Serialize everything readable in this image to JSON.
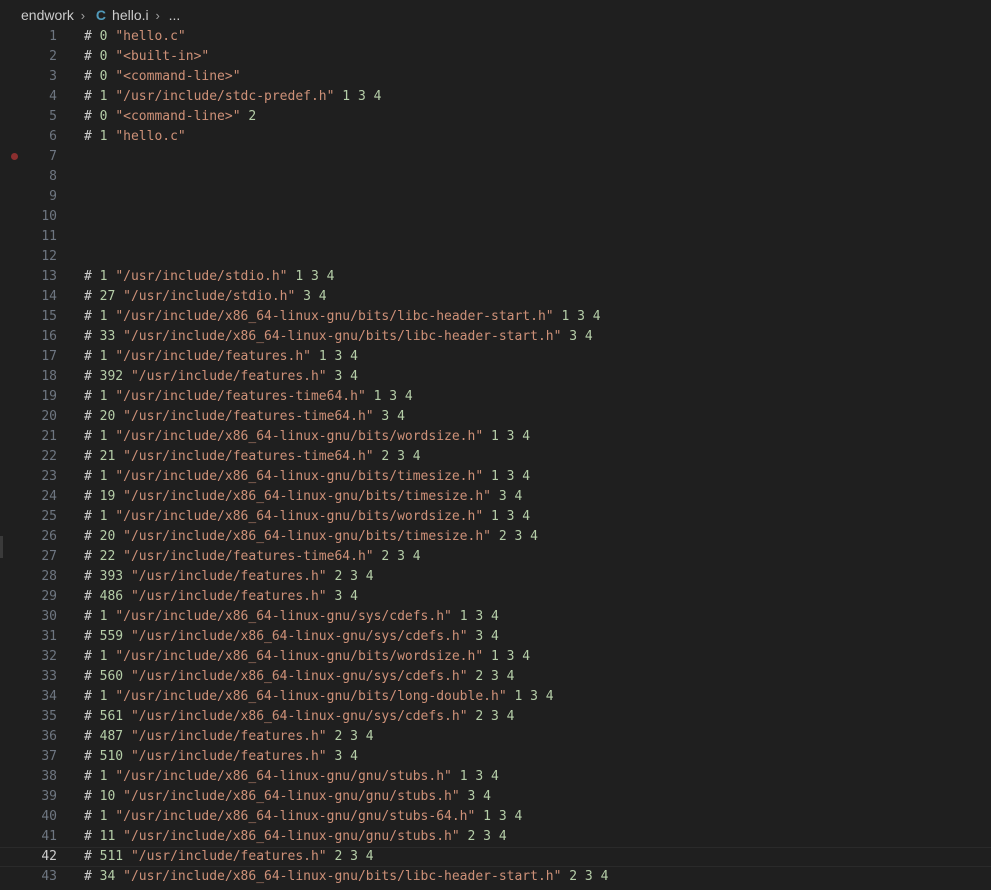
{
  "breadcrumb": {
    "folder": "endwork",
    "file_icon": "C",
    "file": "hello.i",
    "more": "..."
  },
  "colors": {
    "background": "#1f1f1f",
    "line_number": "#6e7681",
    "active_line_number": "#cccccc",
    "string": "#ce9178",
    "number": "#b5cea8",
    "c_icon": "#519aba",
    "breakpoint": "#8c2f2f"
  },
  "editor": {
    "active_line": 42,
    "breakpoint_line": 7,
    "lines": [
      {
        "n": "1",
        "hash": "#",
        "num": "0",
        "str": "\"hello.c\"",
        "flags": ""
      },
      {
        "n": "2",
        "hash": "#",
        "num": "0",
        "str": "\"<built-in>\"",
        "flags": ""
      },
      {
        "n": "3",
        "hash": "#",
        "num": "0",
        "str": "\"<command-line>\"",
        "flags": ""
      },
      {
        "n": "4",
        "hash": "#",
        "num": "1",
        "str": "\"/usr/include/stdc-predef.h\"",
        "flags": "1 3 4"
      },
      {
        "n": "5",
        "hash": "#",
        "num": "0",
        "str": "\"<command-line>\"",
        "flags": "2"
      },
      {
        "n": "6",
        "hash": "#",
        "num": "1",
        "str": "\"hello.c\"",
        "flags": ""
      },
      {
        "n": "7",
        "hash": "",
        "num": "",
        "str": "",
        "flags": ""
      },
      {
        "n": "8",
        "hash": "",
        "num": "",
        "str": "",
        "flags": ""
      },
      {
        "n": "9",
        "hash": "",
        "num": "",
        "str": "",
        "flags": ""
      },
      {
        "n": "10",
        "hash": "",
        "num": "",
        "str": "",
        "flags": ""
      },
      {
        "n": "11",
        "hash": "",
        "num": "",
        "str": "",
        "flags": ""
      },
      {
        "n": "12",
        "hash": "",
        "num": "",
        "str": "",
        "flags": ""
      },
      {
        "n": "13",
        "hash": "#",
        "num": "1",
        "str": "\"/usr/include/stdio.h\"",
        "flags": "1 3 4"
      },
      {
        "n": "14",
        "hash": "#",
        "num": "27",
        "str": "\"/usr/include/stdio.h\"",
        "flags": "3 4"
      },
      {
        "n": "15",
        "hash": "#",
        "num": "1",
        "str": "\"/usr/include/x86_64-linux-gnu/bits/libc-header-start.h\"",
        "flags": "1 3 4"
      },
      {
        "n": "16",
        "hash": "#",
        "num": "33",
        "str": "\"/usr/include/x86_64-linux-gnu/bits/libc-header-start.h\"",
        "flags": "3 4"
      },
      {
        "n": "17",
        "hash": "#",
        "num": "1",
        "str": "\"/usr/include/features.h\"",
        "flags": "1 3 4"
      },
      {
        "n": "18",
        "hash": "#",
        "num": "392",
        "str": "\"/usr/include/features.h\"",
        "flags": "3 4"
      },
      {
        "n": "19",
        "hash": "#",
        "num": "1",
        "str": "\"/usr/include/features-time64.h\"",
        "flags": "1 3 4"
      },
      {
        "n": "20",
        "hash": "#",
        "num": "20",
        "str": "\"/usr/include/features-time64.h\"",
        "flags": "3 4"
      },
      {
        "n": "21",
        "hash": "#",
        "num": "1",
        "str": "\"/usr/include/x86_64-linux-gnu/bits/wordsize.h\"",
        "flags": "1 3 4"
      },
      {
        "n": "22",
        "hash": "#",
        "num": "21",
        "str": "\"/usr/include/features-time64.h\"",
        "flags": "2 3 4"
      },
      {
        "n": "23",
        "hash": "#",
        "num": "1",
        "str": "\"/usr/include/x86_64-linux-gnu/bits/timesize.h\"",
        "flags": "1 3 4"
      },
      {
        "n": "24",
        "hash": "#",
        "num": "19",
        "str": "\"/usr/include/x86_64-linux-gnu/bits/timesize.h\"",
        "flags": "3 4"
      },
      {
        "n": "25",
        "hash": "#",
        "num": "1",
        "str": "\"/usr/include/x86_64-linux-gnu/bits/wordsize.h\"",
        "flags": "1 3 4"
      },
      {
        "n": "26",
        "hash": "#",
        "num": "20",
        "str": "\"/usr/include/x86_64-linux-gnu/bits/timesize.h\"",
        "flags": "2 3 4"
      },
      {
        "n": "27",
        "hash": "#",
        "num": "22",
        "str": "\"/usr/include/features-time64.h\"",
        "flags": "2 3 4"
      },
      {
        "n": "28",
        "hash": "#",
        "num": "393",
        "str": "\"/usr/include/features.h\"",
        "flags": "2 3 4"
      },
      {
        "n": "29",
        "hash": "#",
        "num": "486",
        "str": "\"/usr/include/features.h\"",
        "flags": "3 4"
      },
      {
        "n": "30",
        "hash": "#",
        "num": "1",
        "str": "\"/usr/include/x86_64-linux-gnu/sys/cdefs.h\"",
        "flags": "1 3 4"
      },
      {
        "n": "31",
        "hash": "#",
        "num": "559",
        "str": "\"/usr/include/x86_64-linux-gnu/sys/cdefs.h\"",
        "flags": "3 4"
      },
      {
        "n": "32",
        "hash": "#",
        "num": "1",
        "str": "\"/usr/include/x86_64-linux-gnu/bits/wordsize.h\"",
        "flags": "1 3 4"
      },
      {
        "n": "33",
        "hash": "#",
        "num": "560",
        "str": "\"/usr/include/x86_64-linux-gnu/sys/cdefs.h\"",
        "flags": "2 3 4"
      },
      {
        "n": "34",
        "hash": "#",
        "num": "1",
        "str": "\"/usr/include/x86_64-linux-gnu/bits/long-double.h\"",
        "flags": "1 3 4"
      },
      {
        "n": "35",
        "hash": "#",
        "num": "561",
        "str": "\"/usr/include/x86_64-linux-gnu/sys/cdefs.h\"",
        "flags": "2 3 4"
      },
      {
        "n": "36",
        "hash": "#",
        "num": "487",
        "str": "\"/usr/include/features.h\"",
        "flags": "2 3 4"
      },
      {
        "n": "37",
        "hash": "#",
        "num": "510",
        "str": "\"/usr/include/features.h\"",
        "flags": "3 4"
      },
      {
        "n": "38",
        "hash": "#",
        "num": "1",
        "str": "\"/usr/include/x86_64-linux-gnu/gnu/stubs.h\"",
        "flags": "1 3 4"
      },
      {
        "n": "39",
        "hash": "#",
        "num": "10",
        "str": "\"/usr/include/x86_64-linux-gnu/gnu/stubs.h\"",
        "flags": "3 4"
      },
      {
        "n": "40",
        "hash": "#",
        "num": "1",
        "str": "\"/usr/include/x86_64-linux-gnu/gnu/stubs-64.h\"",
        "flags": "1 3 4"
      },
      {
        "n": "41",
        "hash": "#",
        "num": "11",
        "str": "\"/usr/include/x86_64-linux-gnu/gnu/stubs.h\"",
        "flags": "2 3 4"
      },
      {
        "n": "42",
        "hash": "#",
        "num": "511",
        "str": "\"/usr/include/features.h\"",
        "flags": "2 3 4"
      },
      {
        "n": "43",
        "hash": "#",
        "num": "34",
        "str": "\"/usr/include/x86_64-linux-gnu/bits/libc-header-start.h\"",
        "flags": "2 3 4"
      }
    ]
  }
}
